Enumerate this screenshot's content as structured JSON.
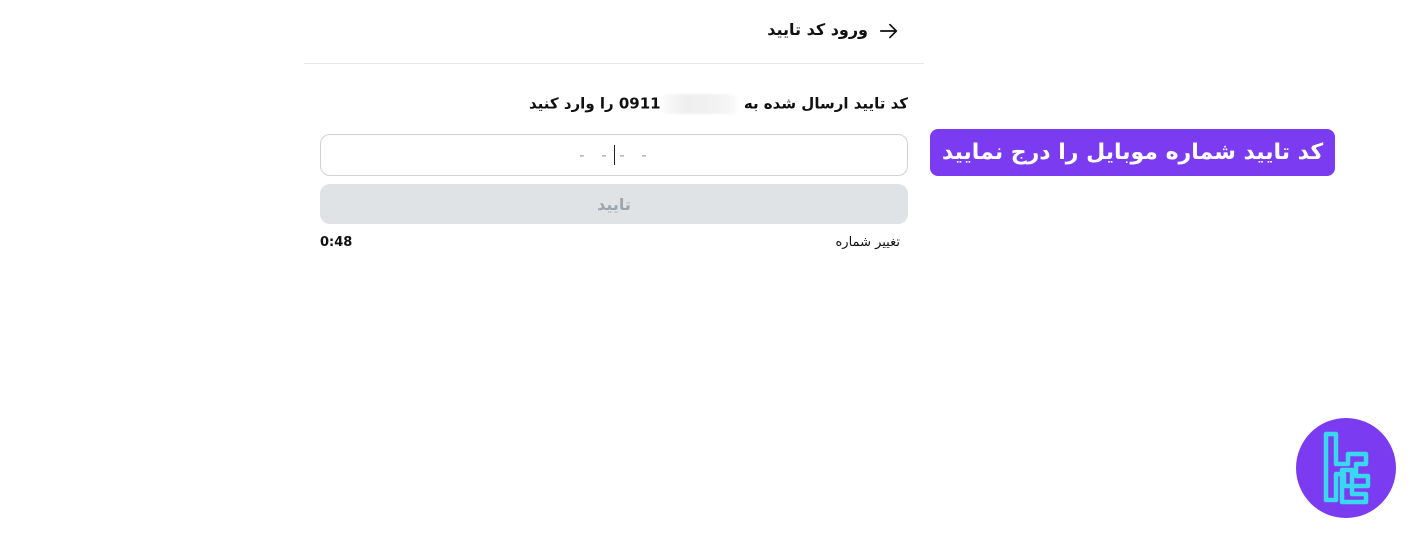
{
  "header": {
    "title": "ورود کد تایید",
    "back_icon": "arrow-right-icon"
  },
  "verification": {
    "instruction_before": "کد تایید ارسال شده به",
    "phone_prefix": "0911",
    "instruction_after": "را وارد کنید",
    "code_placeholder_left": "- -",
    "code_placeholder_right": "- -",
    "confirm_label": "تایید",
    "change_number_label": "تغییر شماره",
    "timer": "0:48"
  },
  "callout": {
    "text": "کد تایید شماره موبایل را درج نمایید"
  },
  "colors": {
    "accent": "#7b3cf1",
    "button_disabled_bg": "#dfe3e6",
    "button_disabled_text": "#9ea6ad",
    "logo_cyan": "#3ad8f0"
  },
  "logo": {
    "icon": "brand-logo-icon"
  }
}
